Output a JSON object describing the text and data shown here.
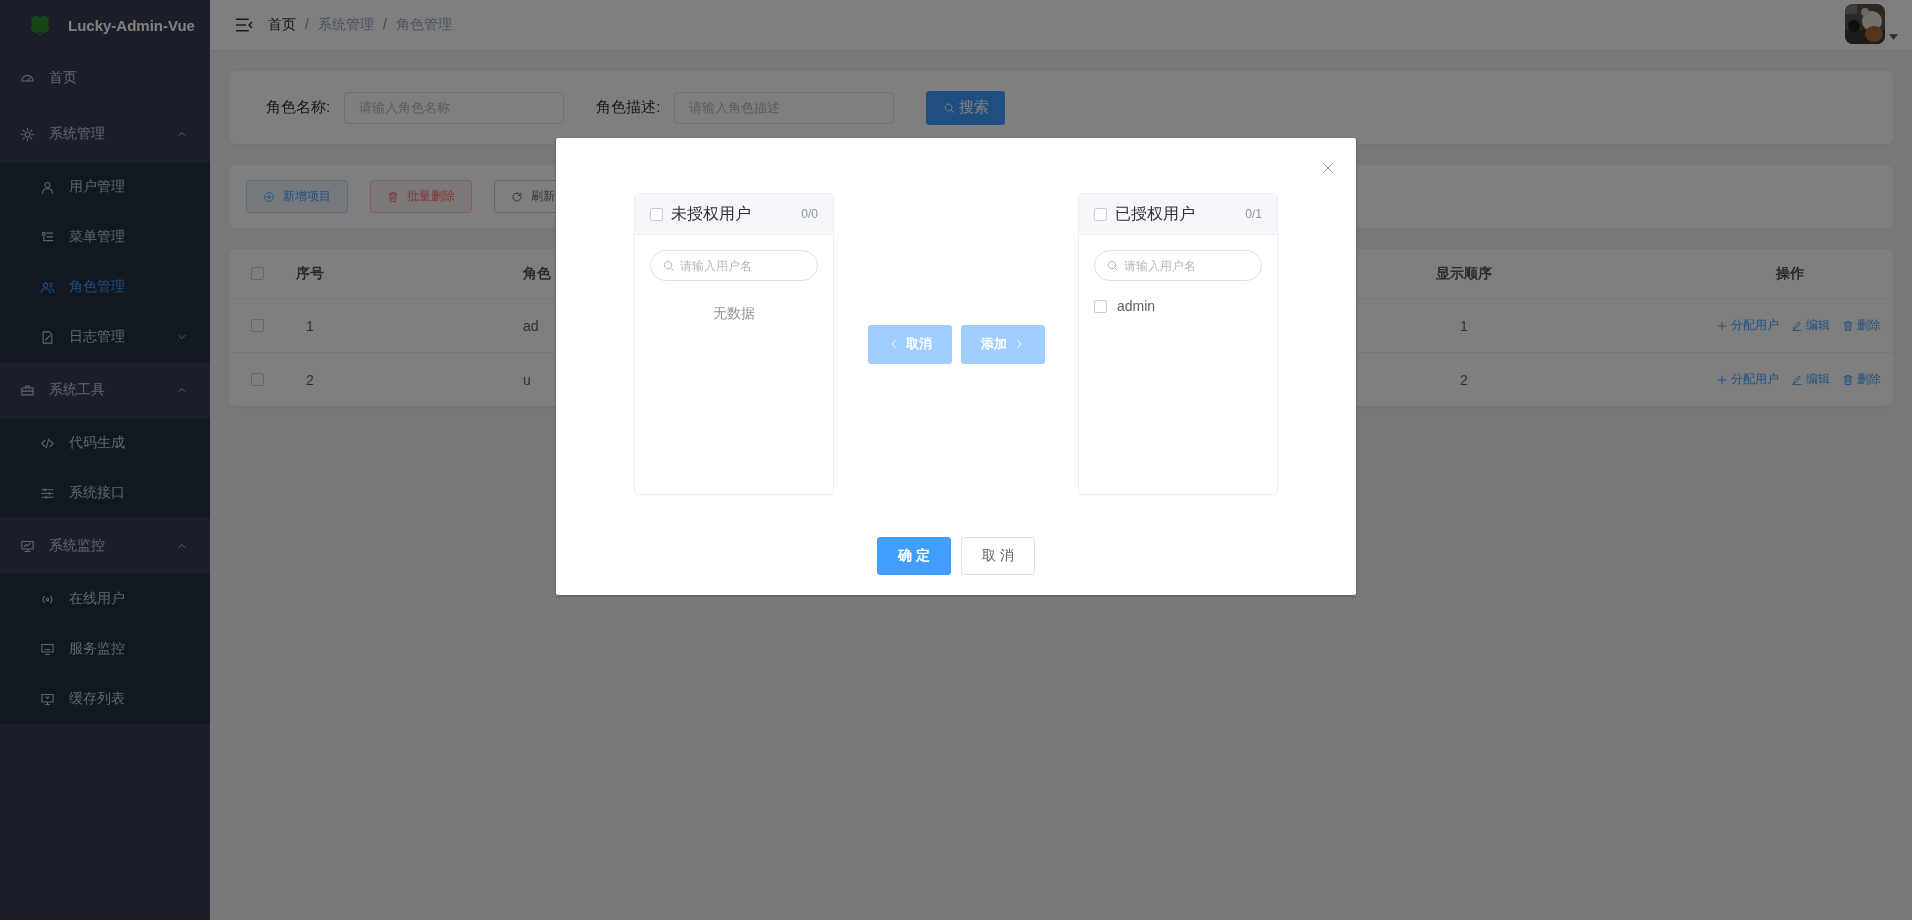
{
  "app": {
    "title": "Lucky-Admin-Vue"
  },
  "sidebar": {
    "items": [
      {
        "label": "首页",
        "kind": "item",
        "selected": false
      },
      {
        "label": "系统管理",
        "kind": "group",
        "expanded": true,
        "children": [
          {
            "label": "用户管理",
            "kind": "item",
            "selected": false
          },
          {
            "label": "菜单管理",
            "kind": "item",
            "selected": false
          },
          {
            "label": "角色管理",
            "kind": "item",
            "selected": true
          },
          {
            "label": "日志管理",
            "kind": "group",
            "expanded": false
          }
        ]
      },
      {
        "label": "系统工具",
        "kind": "group",
        "expanded": true,
        "children": [
          {
            "label": "代码生成",
            "kind": "item",
            "selected": false
          },
          {
            "label": "系统接口",
            "kind": "item",
            "selected": false
          }
        ]
      },
      {
        "label": "系统监控",
        "kind": "group",
        "expanded": true,
        "children": [
          {
            "label": "在线用户",
            "kind": "item",
            "selected": false
          },
          {
            "label": "服务监控",
            "kind": "item",
            "selected": false
          },
          {
            "label": "缓存列表",
            "kind": "item",
            "selected": false
          }
        ]
      }
    ]
  },
  "breadcrumb": {
    "separator": "/",
    "items": [
      {
        "label": "首页"
      },
      {
        "label": "系统管理"
      },
      {
        "label": "角色管理"
      }
    ]
  },
  "search_form": {
    "fields": [
      {
        "label": "角色名称:",
        "placeholder": "请输入角色名称"
      },
      {
        "label": "角色描述:",
        "placeholder": "请输入角色描述"
      }
    ],
    "button": "搜索"
  },
  "toolbar": {
    "buttons": [
      {
        "label": "新增项目",
        "kind": "add"
      },
      {
        "label": "批量删除",
        "kind": "delete"
      },
      {
        "label": "刷新",
        "kind": "refresh"
      }
    ]
  },
  "table": {
    "header_checked": false,
    "columns": [
      {
        "label": "序号"
      },
      {
        "label": "角色"
      },
      {
        "label": "显示顺序"
      },
      {
        "label": "操作"
      }
    ],
    "rows": [
      {
        "checked": false,
        "index": "1",
        "column_3": "ad",
        "order": "1",
        "actions": [
          {
            "kind": "assign",
            "label": "分配用户"
          },
          {
            "kind": "edit",
            "label": "编辑"
          },
          {
            "kind": "delete",
            "label": "删除"
          }
        ]
      },
      {
        "checked": false,
        "index": "2",
        "column_3": "u",
        "order": "2",
        "actions": [
          {
            "kind": "assign",
            "label": "分配用户"
          },
          {
            "kind": "edit",
            "label": "编辑"
          },
          {
            "kind": "delete",
            "label": "删除"
          }
        ]
      }
    ]
  },
  "dialog": {
    "panels": [
      {
        "title": "未授权用户",
        "count": "0/0",
        "checked": false,
        "search": {
          "placeholder": "请输入用户名"
        },
        "empty_text": "无数据"
      },
      {
        "title": "已授权用户",
        "count": "0/1",
        "checked": false,
        "search": {
          "placeholder": "请输入用户名"
        },
        "items": [
          {
            "label": "admin",
            "checked": false
          }
        ]
      }
    ],
    "transfer_buttons": [
      {
        "label": "取消",
        "kind": "left",
        "disabled": true
      },
      {
        "label": "添加",
        "kind": "right",
        "disabled": true
      }
    ],
    "footer_buttons": [
      {
        "label": "确 定",
        "kind": "primary"
      },
      {
        "label": "取 消",
        "kind": "default"
      }
    ]
  }
}
